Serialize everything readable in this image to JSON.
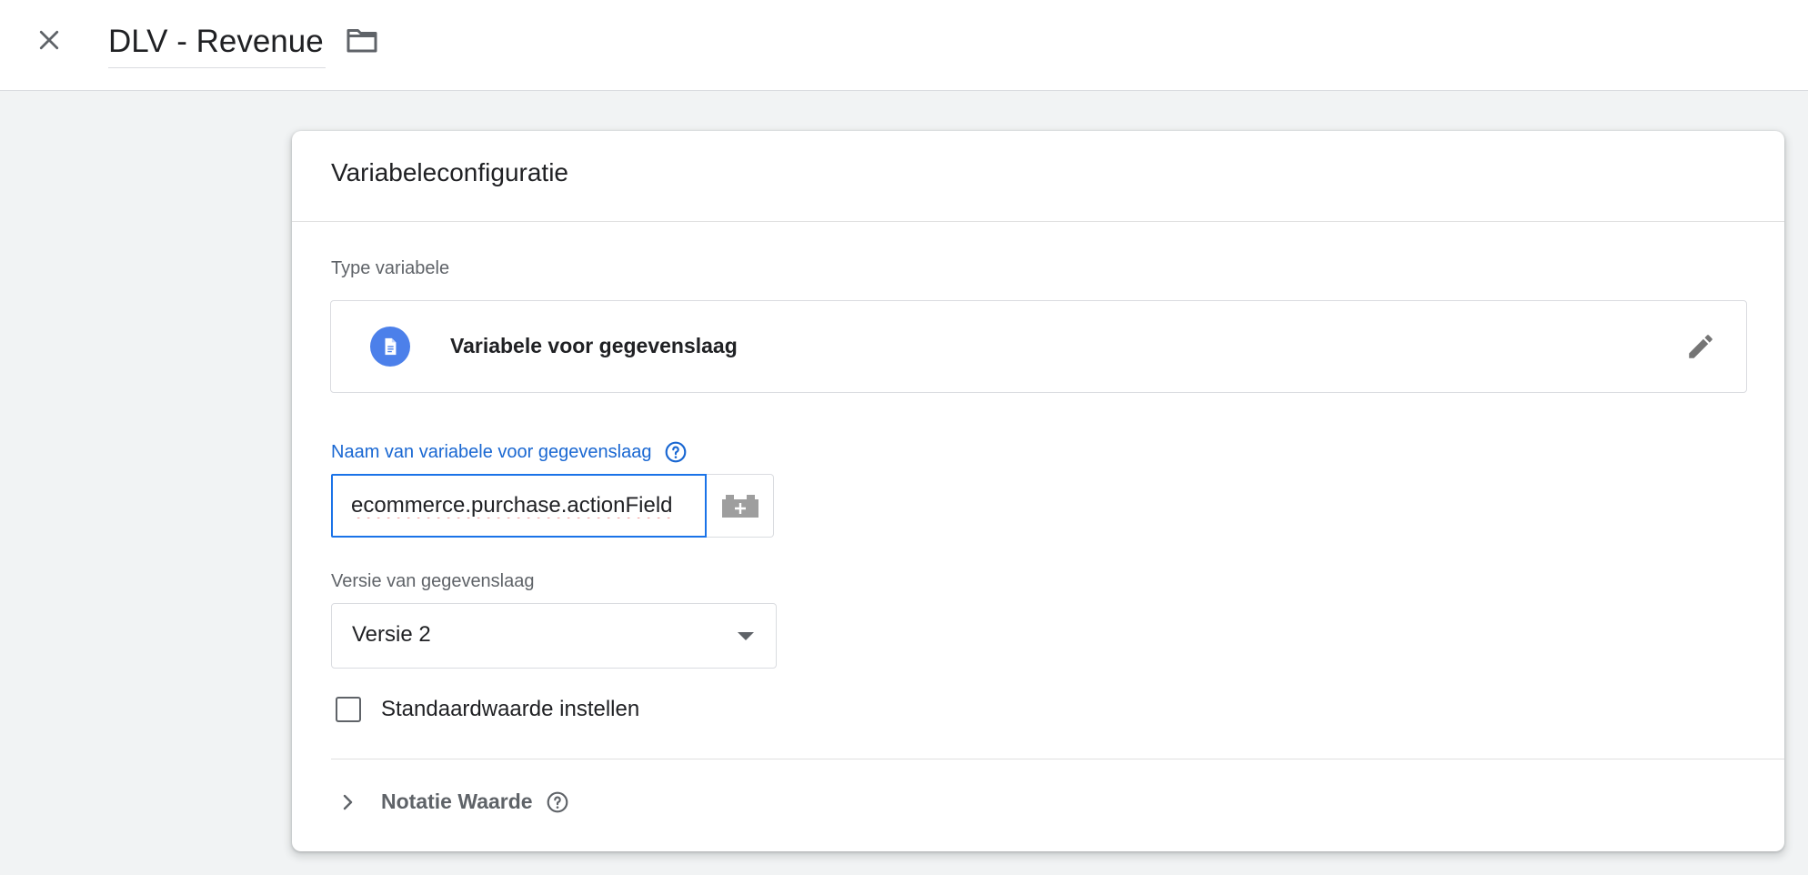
{
  "header": {
    "title": "DLV - Revenue"
  },
  "card": {
    "title": "Variabeleconfiguratie",
    "type_label": "Type variabele",
    "type_name": "Variabele voor gegevenslaag",
    "name_label": "Naam van variabele voor gegevenslaag",
    "name_value": "ecommerce.purchase.actionField",
    "version_label": "Versie van gegevenslaag",
    "version_value": "Versie 2",
    "default_checkbox_label": "Standaardwaarde instellen",
    "format_label": "Notatie Waarde"
  },
  "icons": {
    "close": "close-icon",
    "folder": "folder-icon",
    "type": "document-icon",
    "edit": "pencil-icon",
    "help": "help-icon",
    "variable": "lego-brick-plus-icon",
    "dropdown": "triangle-down-icon",
    "expand": "chevron-right-icon"
  },
  "colors": {
    "accent": "#1a73e8",
    "type_icon_bg": "#4c80ea",
    "page_bg": "#f1f3f4"
  }
}
